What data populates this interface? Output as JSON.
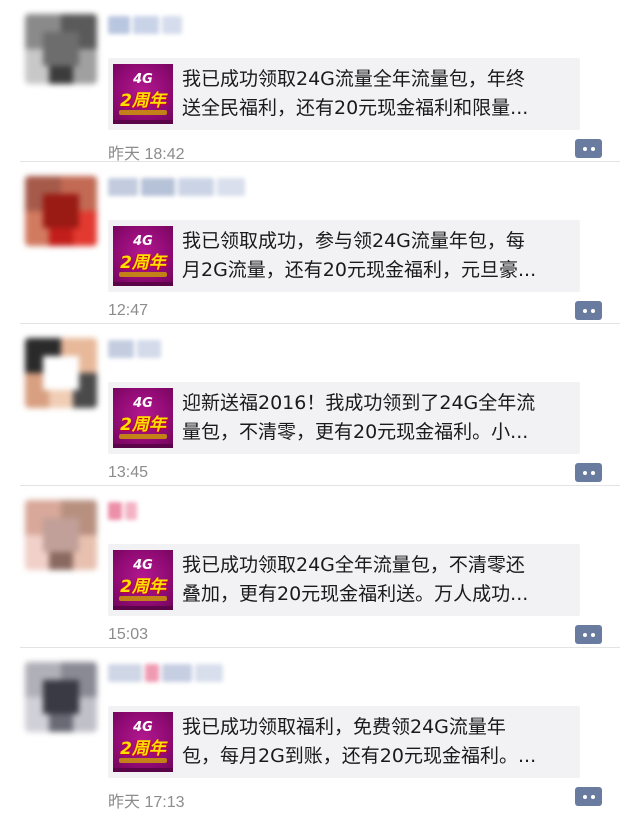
{
  "posts": [
    {
      "avatar_colors": [
        "#8a8a8a",
        "#5a5a5a",
        "#c8c8c8",
        "#3c3c3c",
        "#a0a0a0",
        "#6d6d6d"
      ],
      "nick_colors": [
        "#b9c6e0",
        "#c9d3e8",
        "#d5dcec"
      ],
      "thumb": {
        "top": "4G",
        "main": "2周年"
      },
      "text_line1": "我已成功领取24G流量全年流量包，年终",
      "text_line2": "送全民福利，还有20元现金福利和限量...",
      "time": "昨天 18:42",
      "comment_icon": "comment-icon"
    },
    {
      "avatar_colors": [
        "#a55a4a",
        "#c26a54",
        "#d27a60",
        "#c21e1a",
        "#e23a30",
        "#9a1a14"
      ],
      "nick_colors": [
        "#c2ccde",
        "#b6c2d8",
        "#cbd4e6",
        "#d9dfec"
      ],
      "thumb": {
        "top": "4G",
        "main": "2周年"
      },
      "text_line1": "我已领取成功，参与领24G流量年包，每",
      "text_line2": "月2G流量，还有20元现金福利，元旦豪...",
      "time": "12:47",
      "comment_icon": "comment-icon"
    },
    {
      "avatar_colors": [
        "#2a2a2a",
        "#e8b89a",
        "#d89f80",
        "#f0cdb5",
        "#4a4a4a",
        "#ffffff"
      ],
      "nick_colors": [
        "#c4cde0",
        "#d3daea"
      ],
      "thumb": {
        "top": "4G",
        "main": "2周年"
      },
      "text_line1": "迎新送福2016！我成功领到了24G全年流",
      "text_line2": "量包，不清零，更有20元现金福利。小...",
      "time": "13:45",
      "comment_icon": "comment-icon"
    },
    {
      "avatar_colors": [
        "#d8a89a",
        "#b89080",
        "#f0d0c8",
        "#8a6a60",
        "#e8c0b0",
        "#c0a098"
      ],
      "nick_colors": [
        "#ec8fa8",
        "#f3b3c5"
      ],
      "thumb": {
        "top": "4G",
        "main": "2周年"
      },
      "text_line1": "我已成功领取24G全年流量包，不清零还",
      "text_line2": "叠加，更有20元现金福利送。万人成功...",
      "time": "15:03",
      "comment_icon": "comment-icon"
    },
    {
      "avatar_colors": [
        "#b0b0b8",
        "#8a8a95",
        "#d0d0d8",
        "#6a6a75",
        "#c0c0c8",
        "#3a3a44"
      ],
      "nick_colors": [
        "#cfd6e6",
        "#ef9ab3",
        "#c6cee2",
        "#d8deec"
      ],
      "thumb": {
        "top": "4G",
        "main": "2周年"
      },
      "text_line1": "我已成功领取福利，免费领24G流量年",
      "text_line2": "包，每月2G到账，还有20元现金福利。...",
      "time": "昨天 17:13",
      "comment_icon": "comment-icon"
    }
  ]
}
